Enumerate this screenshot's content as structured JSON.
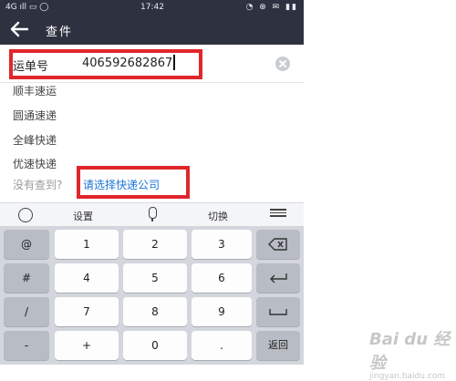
{
  "statusbar": {
    "left": "4G ıll ▭ ◯",
    "time": "17:42",
    "right": "◔ ⊗ ✉ ▮▮"
  },
  "appbar": {
    "title": "查件"
  },
  "search": {
    "label": "运单号",
    "value": "406592682867"
  },
  "suggestions": [
    "顺丰速运",
    "圆通速递",
    "全峰快递",
    "优速快递"
  ],
  "hint": {
    "text": "没有查到?",
    "link": "请选择快递公司"
  },
  "keyboard_toolbar": {
    "settings": "设置",
    "switch": "切换"
  },
  "keys": {
    "row1": [
      "@",
      "1",
      "2",
      "3"
    ],
    "row2": [
      "#",
      "4",
      "5",
      "6"
    ],
    "row3": [
      "/",
      "7",
      "8",
      "9"
    ],
    "row4": [
      "-",
      "+",
      "0",
      ".",
      "返回"
    ]
  },
  "watermark": {
    "brand": "Bai du 经验",
    "url": "jingyan.baidu.com"
  },
  "colors": {
    "appbar": "#2e3240",
    "highlight": "#e0262b",
    "link": "#1c74d8"
  }
}
